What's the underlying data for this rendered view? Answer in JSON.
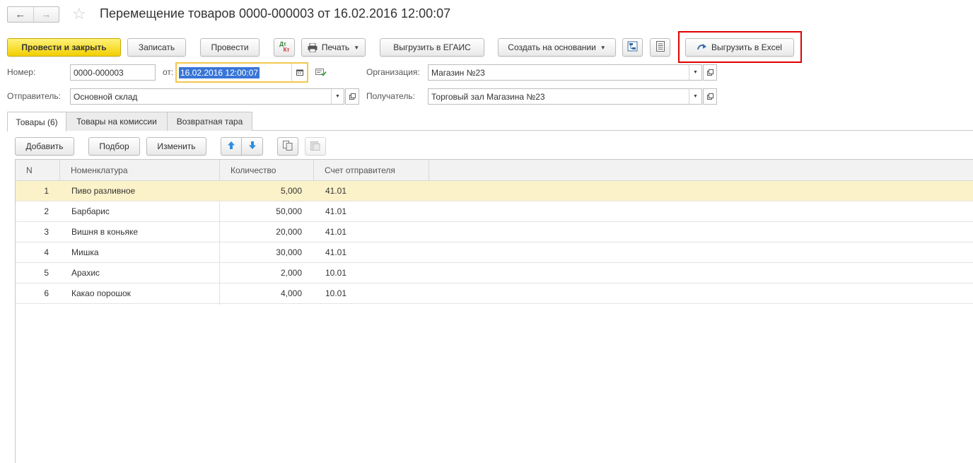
{
  "window": {
    "title": "Перемещение товаров 0000-000003 от 16.02.2016 12:00:07"
  },
  "nav": {
    "back_icon": "←",
    "forward_icon": "→",
    "favorite_icon": "☆"
  },
  "toolbar": {
    "post_close": "Провести и закрыть",
    "save": "Записать",
    "post": "Провести",
    "dt_kt": {
      "top": "Дт",
      "bottom": "Кт"
    },
    "print": "Печать",
    "export_egais": "Выгрузить в ЕГАИС",
    "create_based": "Создать на основании",
    "export_excel": "Выгрузить в Excel"
  },
  "form": {
    "number_label": "Номер:",
    "number_value": "0000-000003",
    "date_label": "от:",
    "date_value": "16.02.2016 12:00:07",
    "org_label": "Организация:",
    "org_value": "Магазин №23",
    "sender_label": "Отправитель:",
    "sender_value": "Основной склад",
    "receiver_label": "Получатель:",
    "receiver_value": "Торговый зал Магазина №23"
  },
  "tabs": [
    {
      "label": "Товары (6)",
      "active": true
    },
    {
      "label": "Товары на комиссии",
      "active": false
    },
    {
      "label": "Возвратная тара",
      "active": false
    }
  ],
  "table_toolbar": {
    "add": "Добавить",
    "pick": "Подбор",
    "change": "Изменить"
  },
  "table": {
    "columns": [
      "N",
      "Номенклатура",
      "Количество",
      "Счет отправителя"
    ],
    "rows": [
      {
        "n": "1",
        "name": "Пиво разливное",
        "qty": "5,000",
        "account": "41.01"
      },
      {
        "n": "2",
        "name": "Барбарис",
        "qty": "50,000",
        "account": "41.01"
      },
      {
        "n": "3",
        "name": "Вишня в коньяке",
        "qty": "20,000",
        "account": "41.01"
      },
      {
        "n": "4",
        "name": "Мишка",
        "qty": "30,000",
        "account": "41.01"
      },
      {
        "n": "5",
        "name": "Арахис",
        "qty": "2,000",
        "account": "10.01"
      },
      {
        "n": "6",
        "name": "Какао порошок",
        "qty": "4,000",
        "account": "10.01"
      }
    ],
    "selected_row": 0
  },
  "colors": {
    "primary_button": "#f2cf00",
    "highlight_frame": "#e00000",
    "selected_row": "#fbf2c9",
    "date_focus": "#f2c94c"
  }
}
